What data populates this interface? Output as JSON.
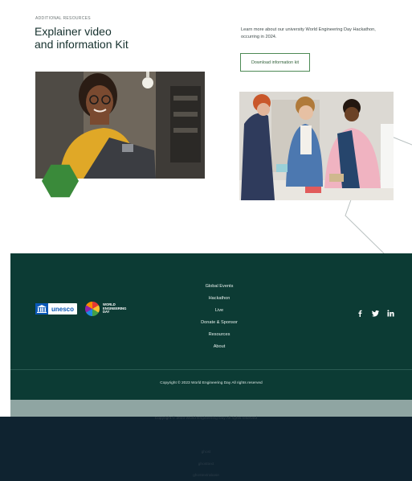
{
  "resources": {
    "eyebrow": "ADDITIONAL RESOURCES",
    "heading_line1": "Explainer video",
    "heading_line2": "and information Kit",
    "lead": "Learn more about our university World Engineering Day Hackathon, occurring in 2024.",
    "download_label": "Download information kit"
  },
  "footer": {
    "logo_unesco": "unesco",
    "logo_wed_line1": "WORLD",
    "logo_wed_line2": "ENGINEERING",
    "logo_wed_line3": "DAY",
    "nav": [
      "Global Events",
      "Hackathon",
      "Live",
      "Donate & Sponsor",
      "Resources",
      "About"
    ],
    "social": [
      "facebook-icon",
      "twitter-icon",
      "linkedin-icon"
    ],
    "copyright": "Copyright © 2023 World Engineering Day All rights reserved"
  },
  "ghost": {
    "copyright": "Copyright © 2023 World Engineering Day All rights reserved",
    "line_a": "ghost",
    "line_b": "ghosttext",
    "line_c": "ghostextrabase"
  },
  "colors": {
    "footer_bg": "#0c3b34",
    "accent_green": "#3a8a3a",
    "button_border": "#4d8a55",
    "overlay_bg": "#0f2330"
  }
}
